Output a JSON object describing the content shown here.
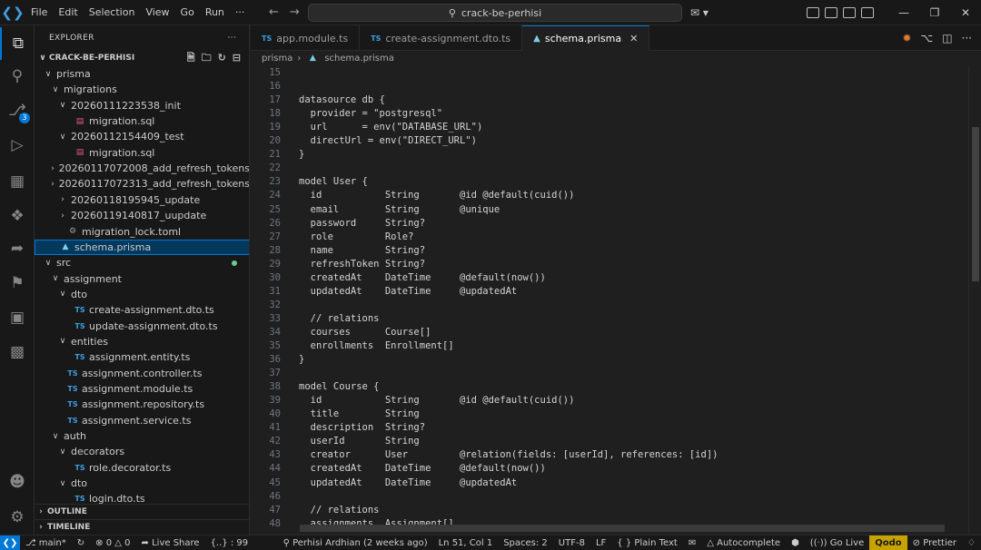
{
  "titlebar": {
    "menu": [
      "File",
      "Edit",
      "Selection",
      "View",
      "Go",
      "Run",
      "···"
    ],
    "search": "crack-be-perhisi",
    "logo_icon": "vscode-logo"
  },
  "activity": {
    "scm_badge": "3"
  },
  "sidebar": {
    "title": "EXPLORER",
    "more": "···",
    "project": "CRACK-BE-PERHISI",
    "outline": "OUTLINE",
    "timeline": "TIMELINE",
    "tree": [
      {
        "label": "prisma",
        "chev": "v",
        "icon": "",
        "indent": 0
      },
      {
        "label": "migrations",
        "chev": "v",
        "icon": "",
        "indent": 1
      },
      {
        "label": "20260111223538_init",
        "chev": "v",
        "icon": "",
        "indent": 2
      },
      {
        "label": "migration.sql",
        "chev": "",
        "icon": "sql",
        "indent": 3
      },
      {
        "label": "20260112154409_test",
        "chev": "v",
        "icon": "",
        "indent": 2
      },
      {
        "label": "migration.sql",
        "chev": "",
        "icon": "sql",
        "indent": 3
      },
      {
        "label": "20260117072008_add_refresh_tokens",
        "chev": ">",
        "icon": "",
        "indent": 2
      },
      {
        "label": "20260117072313_add_refresh_tokens",
        "chev": ">",
        "icon": "",
        "indent": 2
      },
      {
        "label": "20260118195945_update",
        "chev": ">",
        "icon": "",
        "indent": 2
      },
      {
        "label": "20260119140817_uupdate",
        "chev": ">",
        "icon": "",
        "indent": 2
      },
      {
        "label": "migration_lock.toml",
        "chev": "",
        "icon": "toml",
        "indent": 2
      },
      {
        "label": "schema.prisma",
        "chev": "",
        "icon": "prisma",
        "indent": 1,
        "selected": true
      },
      {
        "label": "src",
        "chev": "v",
        "icon": "",
        "indent": 0,
        "modified": true
      },
      {
        "label": "assignment",
        "chev": "v",
        "icon": "",
        "indent": 1
      },
      {
        "label": "dto",
        "chev": "v",
        "icon": "",
        "indent": 2
      },
      {
        "label": "create-assignment.dto.ts",
        "chev": "",
        "icon": "ts",
        "indent": 3
      },
      {
        "label": "update-assignment.dto.ts",
        "chev": "",
        "icon": "ts",
        "indent": 3
      },
      {
        "label": "entities",
        "chev": "v",
        "icon": "",
        "indent": 2
      },
      {
        "label": "assignment.entity.ts",
        "chev": "",
        "icon": "ts",
        "indent": 3
      },
      {
        "label": "assignment.controller.ts",
        "chev": "",
        "icon": "ts",
        "indent": 2
      },
      {
        "label": "assignment.module.ts",
        "chev": "",
        "icon": "ts",
        "indent": 2
      },
      {
        "label": "assignment.repository.ts",
        "chev": "",
        "icon": "ts",
        "indent": 2
      },
      {
        "label": "assignment.service.ts",
        "chev": "",
        "icon": "ts",
        "indent": 2
      },
      {
        "label": "auth",
        "chev": "v",
        "icon": "",
        "indent": 1
      },
      {
        "label": "decorators",
        "chev": "v",
        "icon": "",
        "indent": 2
      },
      {
        "label": "role.decorator.ts",
        "chev": "",
        "icon": "ts",
        "indent": 3
      },
      {
        "label": "dto",
        "chev": "v",
        "icon": "",
        "indent": 2
      },
      {
        "label": "login.dto.ts",
        "chev": "",
        "icon": "ts",
        "indent": 3
      }
    ]
  },
  "tabs": [
    {
      "label": "app.module.ts",
      "icon": "TS",
      "active": false
    },
    {
      "label": "create-assignment.dto.ts",
      "icon": "TS",
      "active": false
    },
    {
      "label": "schema.prisma",
      "icon": "prisma",
      "active": true
    }
  ],
  "breadcrumb": {
    "folder": "prisma",
    "file": "schema.prisma"
  },
  "code": [
    {
      "n": "15",
      "t": ""
    },
    {
      "n": "16",
      "t": ""
    },
    {
      "n": "17",
      "t": "datasource db {"
    },
    {
      "n": "18",
      "t": "  provider = \"postgresql\""
    },
    {
      "n": "19",
      "t": "  url      = env(\"DATABASE_URL\")"
    },
    {
      "n": "20",
      "t": "  directUrl = env(\"DIRECT_URL\")"
    },
    {
      "n": "21",
      "t": "}"
    },
    {
      "n": "22",
      "t": ""
    },
    {
      "n": "23",
      "t": "model User {"
    },
    {
      "n": "24",
      "t": "  id           String       @id @default(cuid())"
    },
    {
      "n": "25",
      "t": "  email        String       @unique"
    },
    {
      "n": "26",
      "t": "  password     String?"
    },
    {
      "n": "27",
      "t": "  role         Role?"
    },
    {
      "n": "28",
      "t": "  name         String?"
    },
    {
      "n": "29",
      "t": "  refreshToken String?"
    },
    {
      "n": "30",
      "t": "  createdAt    DateTime     @default(now())"
    },
    {
      "n": "31",
      "t": "  updatedAt    DateTime     @updatedAt"
    },
    {
      "n": "32",
      "t": ""
    },
    {
      "n": "33",
      "t": "  // relations"
    },
    {
      "n": "34",
      "t": "  courses      Course[]"
    },
    {
      "n": "35",
      "t": "  enrollments  Enrollment[]"
    },
    {
      "n": "36",
      "t": "}"
    },
    {
      "n": "37",
      "t": ""
    },
    {
      "n": "38",
      "t": "model Course {"
    },
    {
      "n": "39",
      "t": "  id           String       @id @default(cuid())"
    },
    {
      "n": "40",
      "t": "  title        String"
    },
    {
      "n": "41",
      "t": "  description  String?"
    },
    {
      "n": "42",
      "t": "  userId       String"
    },
    {
      "n": "43",
      "t": "  creator      User         @relation(fields: [userId], references: [id])"
    },
    {
      "n": "44",
      "t": "  createdAt    DateTime     @default(now())"
    },
    {
      "n": "45",
      "t": "  updatedAt    DateTime     @updatedAt"
    },
    {
      "n": "46",
      "t": ""
    },
    {
      "n": "47",
      "t": "  // relations"
    },
    {
      "n": "48",
      "t": "  assignments  Assignment[]"
    }
  ],
  "status": {
    "branch": "main*",
    "errors": "0",
    "warnings": "0",
    "live_share": "Live Share",
    "braces": "{..} : 99",
    "blame": "Perhisi Ardhian (2 weeks ago)",
    "position": "Ln 51, Col 1",
    "spaces": "Spaces: 2",
    "encoding": "UTF-8",
    "eol": "LF",
    "language": "Plain Text",
    "autocomplete": "Autocomplete",
    "golive": "Go Live",
    "qodo": "Qodo",
    "prettier": "Prettier"
  },
  "colors": {
    "accent": "#0078d4",
    "selection": "#04395e",
    "ts": "#3c9ee5",
    "sql": "#e05b7f",
    "qodo": "#c8a200"
  }
}
